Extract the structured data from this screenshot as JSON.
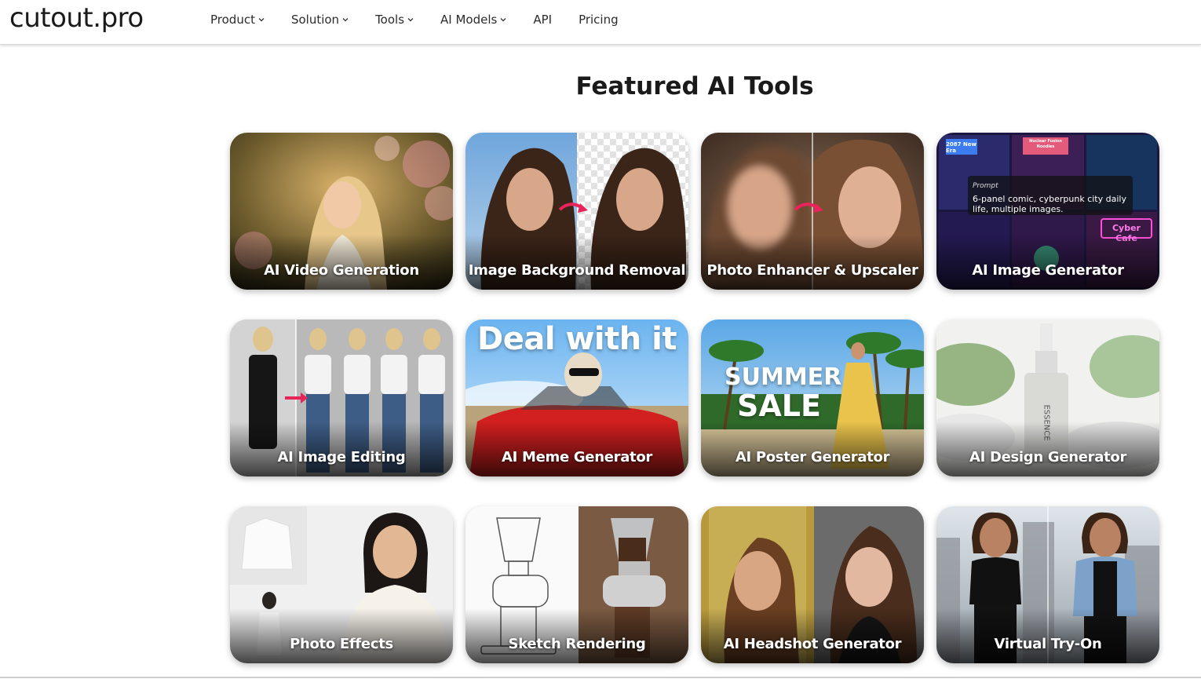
{
  "header": {
    "logo": "cutout.pro",
    "nav": [
      {
        "label": "Product",
        "has_dropdown": true
      },
      {
        "label": "Solution",
        "has_dropdown": true
      },
      {
        "label": "Tools",
        "has_dropdown": true
      },
      {
        "label": "AI Models",
        "has_dropdown": true
      },
      {
        "label": "API",
        "has_dropdown": false
      },
      {
        "label": "Pricing",
        "has_dropdown": false
      }
    ]
  },
  "main": {
    "title": "Featured AI Tools",
    "cards": [
      {
        "label": "AI Video Generation"
      },
      {
        "label": "Image Background Removal"
      },
      {
        "label": "Photo Enhancer & Upscaler"
      },
      {
        "label": "AI Image Generator",
        "prompt_heading": "Prompt",
        "prompt_text": "6-panel comic, cyberpunk city daily life, multiple images.",
        "signs": [
          "2087 New Era",
          "Nuclear Fusion Noodles",
          "Cyber Cafe"
        ]
      },
      {
        "label": "AI Image Editing"
      },
      {
        "label": "AI Meme Generator",
        "headline": "Deal with it"
      },
      {
        "label": "AI Poster Generator",
        "headline_1": "SUMMER",
        "headline_2": "SALE"
      },
      {
        "label": "AI Design Generator",
        "bottle_text": "ESSENCE"
      },
      {
        "label": "Photo Effects"
      },
      {
        "label": "Sketch Rendering"
      },
      {
        "label": "AI Headshot Generator"
      },
      {
        "label": "Virtual Try-On"
      }
    ]
  },
  "colors": {
    "accent_arrow": "#e8245a",
    "text_dark": "#1a1a1a"
  }
}
